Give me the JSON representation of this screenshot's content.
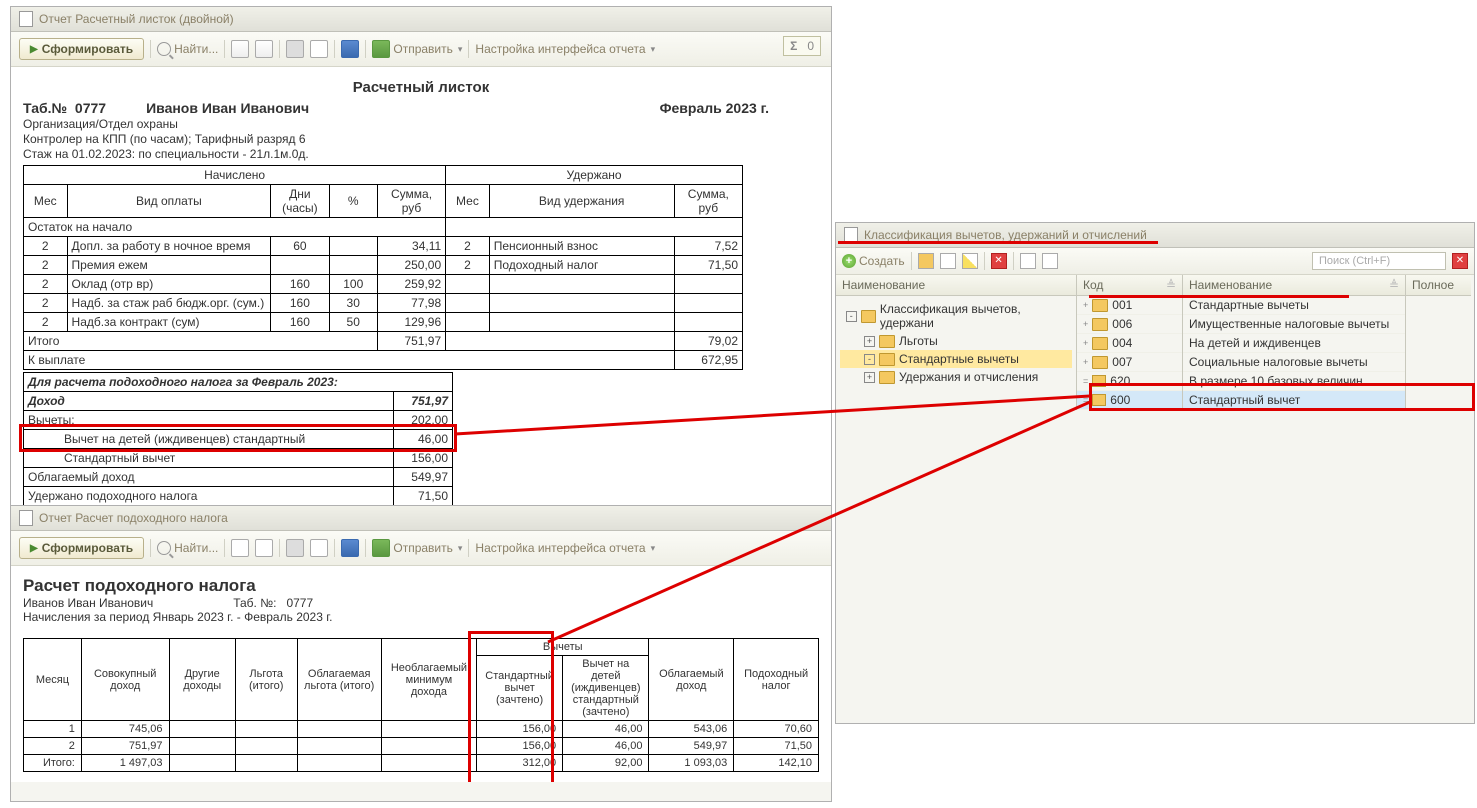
{
  "win1": {
    "title": "Отчет Расчетный листок (двойной)",
    "toolbar": {
      "form": "Сформировать",
      "find": "Найти...",
      "send": "Отправить",
      "cfg": "Настройка интерфейса отчета"
    },
    "sigma": "0",
    "report_title": "Расчетный листок",
    "tab_label": "Таб.№",
    "tab_num": "0777",
    "emp": "Иванов Иван Иванович",
    "period": "Февраль 2023 г.",
    "org": "Организация/Отдел охраны",
    "job": "Контролер на КПП (по часам); Тарифный разряд 6",
    "stazh": "Стаж на 01.02.2023: по специальности - 21л.1м.0д.",
    "earn_hdr": "Начислено",
    "ded_hdr": "Удержано",
    "cols": {
      "mes": "Мес",
      "vid_opl": "Вид оплаты",
      "dni": "Дни (часы)",
      "pct": "%",
      "sum": "Сумма, руб",
      "vid_ud": "Вид удержания"
    },
    "ostatok": "Остаток на начало",
    "rows_earn": [
      {
        "m": "2",
        "name": "Допл. за работу в ночное время",
        "dni": "60",
        "pct": "",
        "sum": "34,11"
      },
      {
        "m": "2",
        "name": "Премия ежем",
        "dni": "",
        "pct": "",
        "sum": "250,00"
      },
      {
        "m": "2",
        "name": "Оклад (отр вр)",
        "dni": "160",
        "pct": "100",
        "sum": "259,92"
      },
      {
        "m": "2",
        "name": "Надб. за стаж раб бюдж.орг. (сум.)",
        "dni": "160",
        "pct": "30",
        "sum": "77,98"
      },
      {
        "m": "2",
        "name": "Надб.за контракт (сум)",
        "dni": "160",
        "pct": "50",
        "sum": "129,96"
      }
    ],
    "rows_ded": [
      {
        "m": "2",
        "name": "Пенсионный взнос",
        "sum": "7,52"
      },
      {
        "m": "2",
        "name": "Подоходный налог",
        "sum": "71,50"
      }
    ],
    "itogo": "Итого",
    "itogo_e": "751,97",
    "itogo_d": "79,02",
    "k_vypl": "К выплате",
    "k_vypl_s": "672,95",
    "tax_hdr": "Для расчета подоходного налога за Февраль 2023:",
    "tax": [
      {
        "n": "Доход",
        "v": "751,97",
        "b": true
      },
      {
        "n": "Вычеты:",
        "v": "202,00"
      },
      {
        "n": "Вычет на детей (иждивенцев) стандартный",
        "v": "46,00",
        "indent": true
      },
      {
        "n": "Стандартный вычет",
        "v": "156,00",
        "indent": true
      },
      {
        "n": "Облагаемый доход",
        "v": "549,97"
      },
      {
        "n": "Удержано подоходного налога",
        "v": "71,50"
      }
    ]
  },
  "win2": {
    "title": "Отчет Расчет подоходного налога",
    "toolbar": {
      "form": "Сформировать",
      "find": "Найти...",
      "send": "Отправить",
      "cfg": "Настройка интерфейса отчета"
    },
    "h": "Расчет подоходного налога",
    "emp": "Иванов Иван Иванович",
    "tab_l": "Таб. №:",
    "tab": "0777",
    "period": "Начисления за период Январь 2023 г. - Февраль 2023 г.",
    "cols": [
      "Месяц",
      "Совокупный доход",
      "Другие доходы",
      "Льгота (итого)",
      "Облагаемая льгота (итого)",
      "Необлагаемый минимум дохода",
      "Стандартный вычет (зачтено)",
      "Вычет на детей (иждивенцев) стандартный (зачтено)",
      "Облагаемый доход",
      "Подоходный налог"
    ],
    "vychety": "Вычеты",
    "rows": [
      {
        "m": "1",
        "sov": "745,06",
        "std": "156,00",
        "det": "46,00",
        "obl": "543,06",
        "nal": "70,60"
      },
      {
        "m": "2",
        "sov": "751,97",
        "std": "156,00",
        "det": "46,00",
        "obl": "549,97",
        "nal": "71,50"
      }
    ],
    "itogo": "Итого:",
    "tot": {
      "sov": "1 497,03",
      "std": "312,00",
      "det": "92,00",
      "obl": "1 093,03",
      "nal": "142,10"
    }
  },
  "win3": {
    "title": "Классификация вычетов, удержаний и отчислений",
    "create": "Создать",
    "search_ph": "Поиск (Ctrl+F)",
    "left_hdr": "Наименование",
    "tree": [
      {
        "t": "Классификация вычетов, удержани",
        "lvl": 0,
        "exp": "-"
      },
      {
        "t": "Льготы",
        "lvl": 1,
        "exp": "+"
      },
      {
        "t": "Стандартные вычеты",
        "lvl": 1,
        "exp": "-",
        "sel": true
      },
      {
        "t": "Удержания и отчисления",
        "lvl": 1,
        "exp": "+"
      }
    ],
    "cols": {
      "code": "Код",
      "name": "Наименование",
      "full": "Полное"
    },
    "rows": [
      {
        "c": "001",
        "n": "Стандартные вычеты",
        "f": true
      },
      {
        "c": "006",
        "n": "Имущественные налоговые вычеты",
        "f": true
      },
      {
        "c": "004",
        "n": "На детей и иждивенцев",
        "f": true
      },
      {
        "c": "007",
        "n": "Социальные налоговые вычеты",
        "f": true
      },
      {
        "c": "620",
        "n": "В размере 10 базовых величин"
      },
      {
        "c": "600",
        "n": "Стандартный вычет",
        "sel": true
      }
    ]
  }
}
